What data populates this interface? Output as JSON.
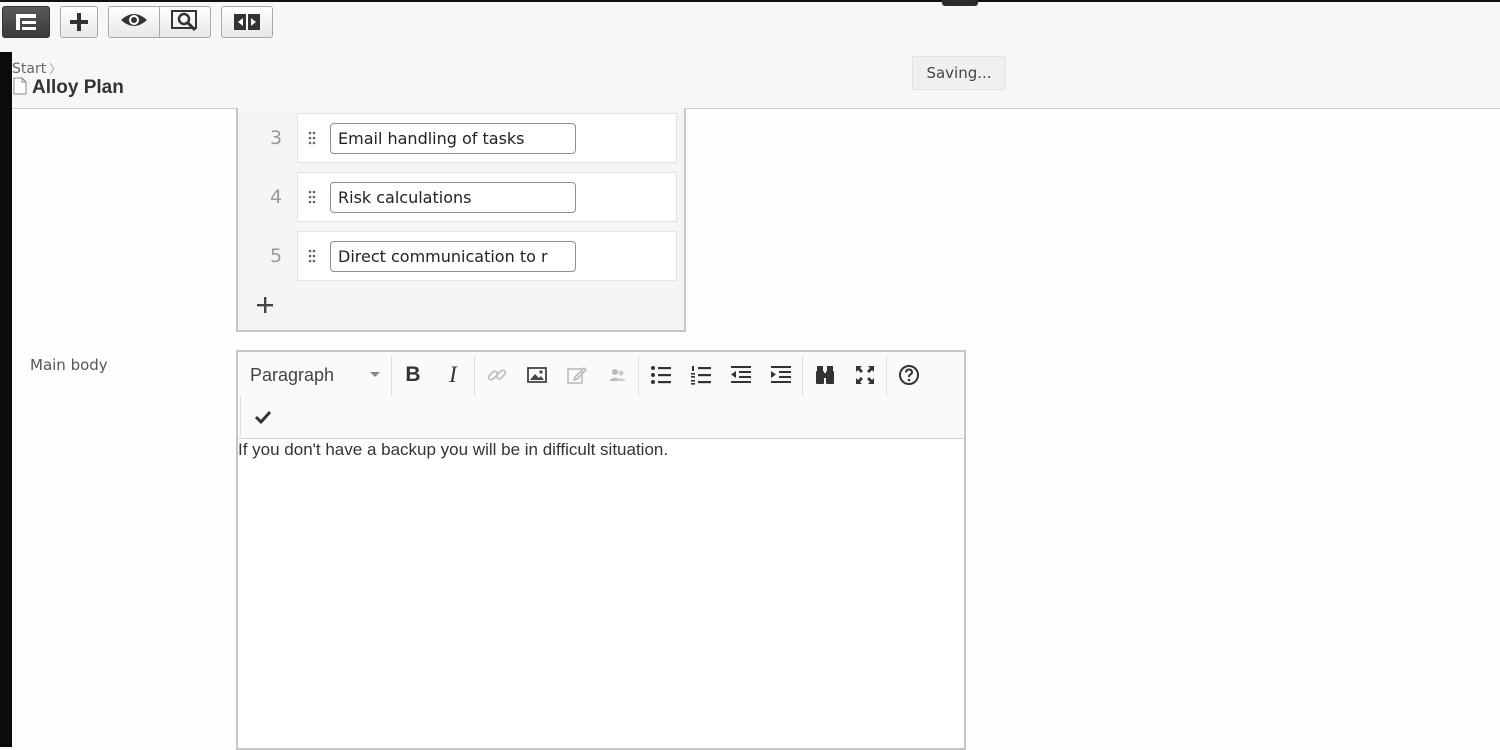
{
  "toolbar": {
    "icons": [
      "page-tree-icon",
      "plus-icon",
      "eye-icon",
      "preview-icon",
      "compare-icon"
    ]
  },
  "breadcrumb": {
    "parent": "Start",
    "page_title": "Alloy Plan"
  },
  "status": {
    "saving": "Saving..."
  },
  "list": {
    "items": [
      {
        "number": "3",
        "value": "Email handling of tasks"
      },
      {
        "number": "4",
        "value": "Risk calculations"
      },
      {
        "number": "5",
        "value": "Direct communication to r"
      }
    ]
  },
  "main_body": {
    "label": "Main body",
    "format": "Paragraph",
    "content": "If you don't have a backup you will be in difficult situation.",
    "toolbar_icons": [
      "bold-icon",
      "italic-icon",
      "link-icon",
      "image-icon",
      "edit-icon",
      "personalize-icon",
      "bullet-list-icon",
      "numbered-list-icon",
      "outdent-icon",
      "indent-icon",
      "find-icon",
      "fullscreen-icon",
      "help-icon",
      "check-icon"
    ]
  }
}
